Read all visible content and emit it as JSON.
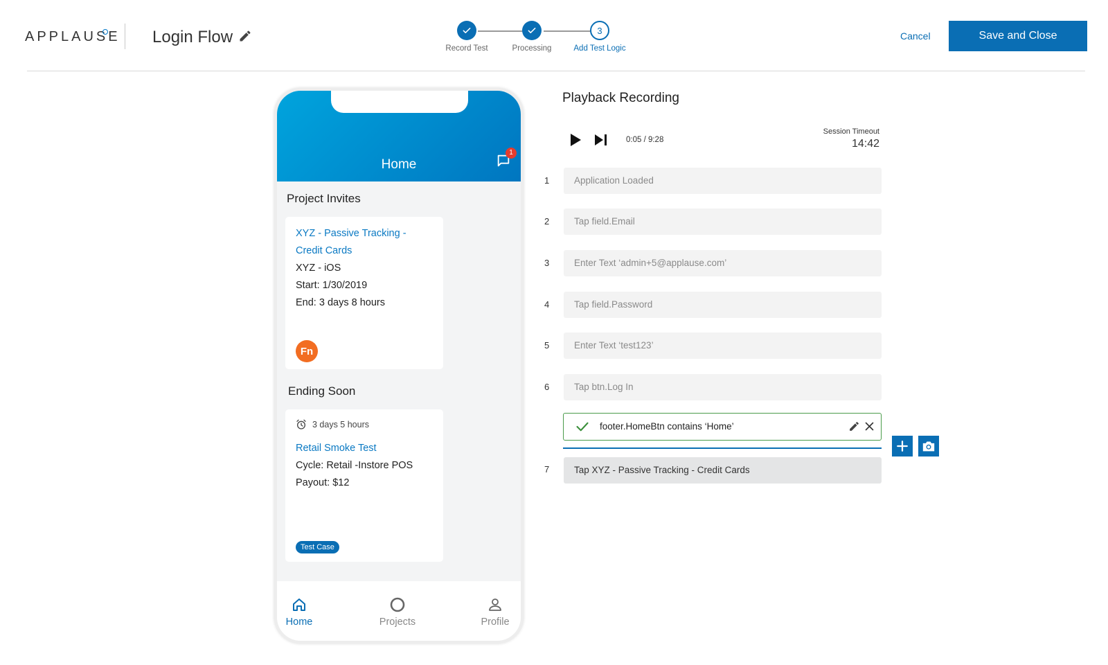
{
  "header": {
    "logo_text": "APPLAUSE",
    "title": "Login Flow",
    "cancel_label": "Cancel",
    "save_label": "Save and Close"
  },
  "stepper": {
    "steps": [
      {
        "label": "Record Test",
        "state": "done"
      },
      {
        "label": "Processing",
        "state": "done"
      },
      {
        "label": "Add Test Logic",
        "state": "active",
        "number": "3"
      }
    ]
  },
  "phone": {
    "title": "Home",
    "notification_count": "1",
    "invites_title": "Project Invites",
    "invite_card": {
      "link_line1": "XYZ - Passive Tracking -",
      "link_line2": "Credit Cards",
      "platform": "XYZ - iOS",
      "start": "Start: 1/30/2019",
      "end": "End: 3 days 8 hours",
      "avatar": "Fn"
    },
    "ending_title": "Ending Soon",
    "ending_card": {
      "timer": "3 days 5 hours",
      "link": "Retail Smoke Test",
      "cycle": "Cycle: Retail -Instore POS",
      "payout": "Payout: $12",
      "tag": "Test Case"
    },
    "tabs": [
      {
        "label": "Home",
        "icon": "home-icon",
        "active": true
      },
      {
        "label": "Projects",
        "icon": "circle-icon",
        "active": false
      },
      {
        "label": "Profile",
        "icon": "person-icon",
        "active": false
      }
    ]
  },
  "playback": {
    "title": "Playback Recording",
    "time": "0:05 / 9:28",
    "session_label": "Session Timeout",
    "session_value": "14:42",
    "steps": [
      {
        "num": "1",
        "text": "Application Loaded"
      },
      {
        "num": "2",
        "text": "Tap field.Email"
      },
      {
        "num": "3",
        "text": "Enter Text ‘admin+5@applause.com’"
      },
      {
        "num": "4",
        "text": "Tap field.Password"
      },
      {
        "num": "5",
        "text": "Enter Text ‘test123’"
      },
      {
        "num": "6",
        "text": "Tap btn.Log In"
      }
    ],
    "assertion": "footer.HomeBtn contains ‘Home’",
    "step7": {
      "num": "7",
      "text": "Tap XYZ - Passive Tracking - Credit Cards"
    }
  },
  "colors": {
    "primary": "#0a6eb4",
    "success": "#4a9b4a",
    "avatar": "#f26d22",
    "badge": "#e53c2e"
  }
}
